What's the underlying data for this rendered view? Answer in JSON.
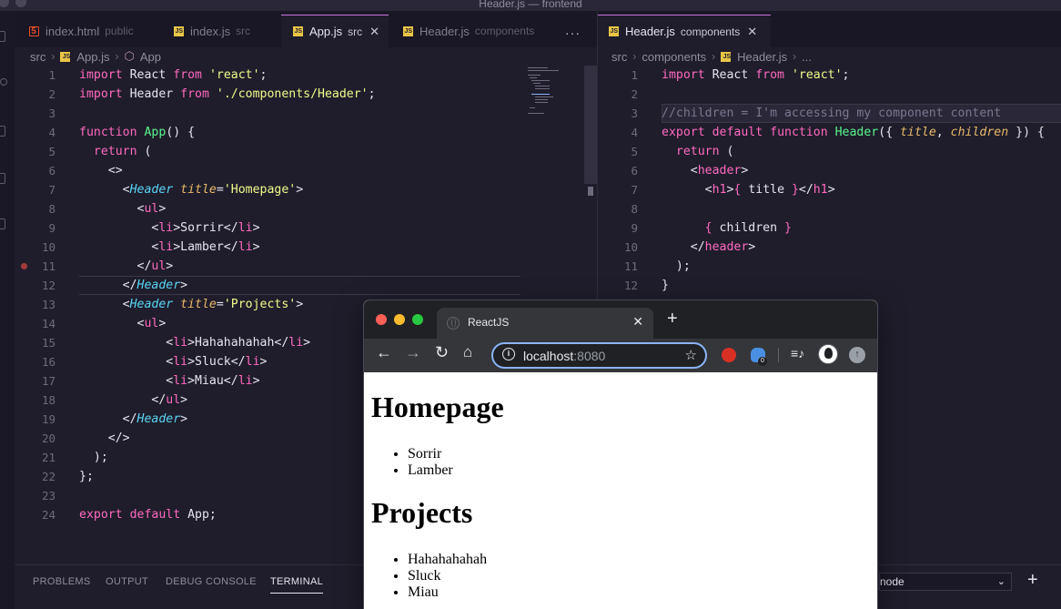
{
  "window": {
    "title": "Header.js — frontend"
  },
  "left_pane": {
    "tabs": [
      {
        "name": "index.html",
        "dir": "public",
        "icon": "html-file-icon"
      },
      {
        "name": "index.js",
        "dir": "src",
        "icon": "js-file-icon"
      },
      {
        "name": "App.js",
        "dir": "src",
        "icon": "js-file-icon",
        "active": true
      },
      {
        "name": "Header.js",
        "dir": "components",
        "icon": "js-file-icon"
      }
    ],
    "more_label": "···",
    "close_glyph": "✕",
    "breadcrumb": {
      "folder": "src",
      "file": "App.js",
      "symbol": "App"
    },
    "lines": [
      "1",
      "2",
      "3",
      "4",
      "5",
      "6",
      "7",
      "8",
      "9",
      "10",
      "11",
      "12",
      "13",
      "14",
      "15",
      "16",
      "17",
      "18",
      "19",
      "20",
      "21",
      "22",
      "23",
      "24"
    ]
  },
  "right_pane": {
    "tab": {
      "name": "Header.js",
      "dir": "components"
    },
    "breadcrumb": {
      "folder": "src",
      "subfolder": "components",
      "file": "Header.js",
      "ellipsis": "..."
    },
    "lines": [
      "1",
      "2",
      "3",
      "4",
      "5",
      "6",
      "7",
      "8",
      "9",
      "10",
      "11",
      "12"
    ]
  },
  "panel": {
    "tabs": [
      "PROBLEMS",
      "OUTPUT",
      "DEBUG CONSOLE",
      "TERMINAL"
    ],
    "active_tab": "TERMINAL",
    "terminal_select": "node",
    "add_glyph": "+"
  },
  "browser": {
    "tab_title": "ReactJS",
    "url_host": "localhost",
    "url_port": ":8080",
    "ext_badge": "0",
    "page": {
      "sections": [
        {
          "heading": "Homepage",
          "items": [
            "Sorrir",
            "Lamber"
          ]
        },
        {
          "heading": "Projects",
          "items": [
            "Hahahahahah",
            "Sluck",
            "Miau"
          ]
        }
      ]
    }
  },
  "colors": {
    "editor_bg": "#1f1d2b",
    "keyword": "#ff6ac1",
    "string": "#f1fa8c",
    "function": "#5af78e",
    "component": "#5ad4f5",
    "attribute": "#e8b96a",
    "comment": "#7a7790",
    "browser_chrome": "#35363a",
    "focus_ring": "#8ab4f8"
  }
}
